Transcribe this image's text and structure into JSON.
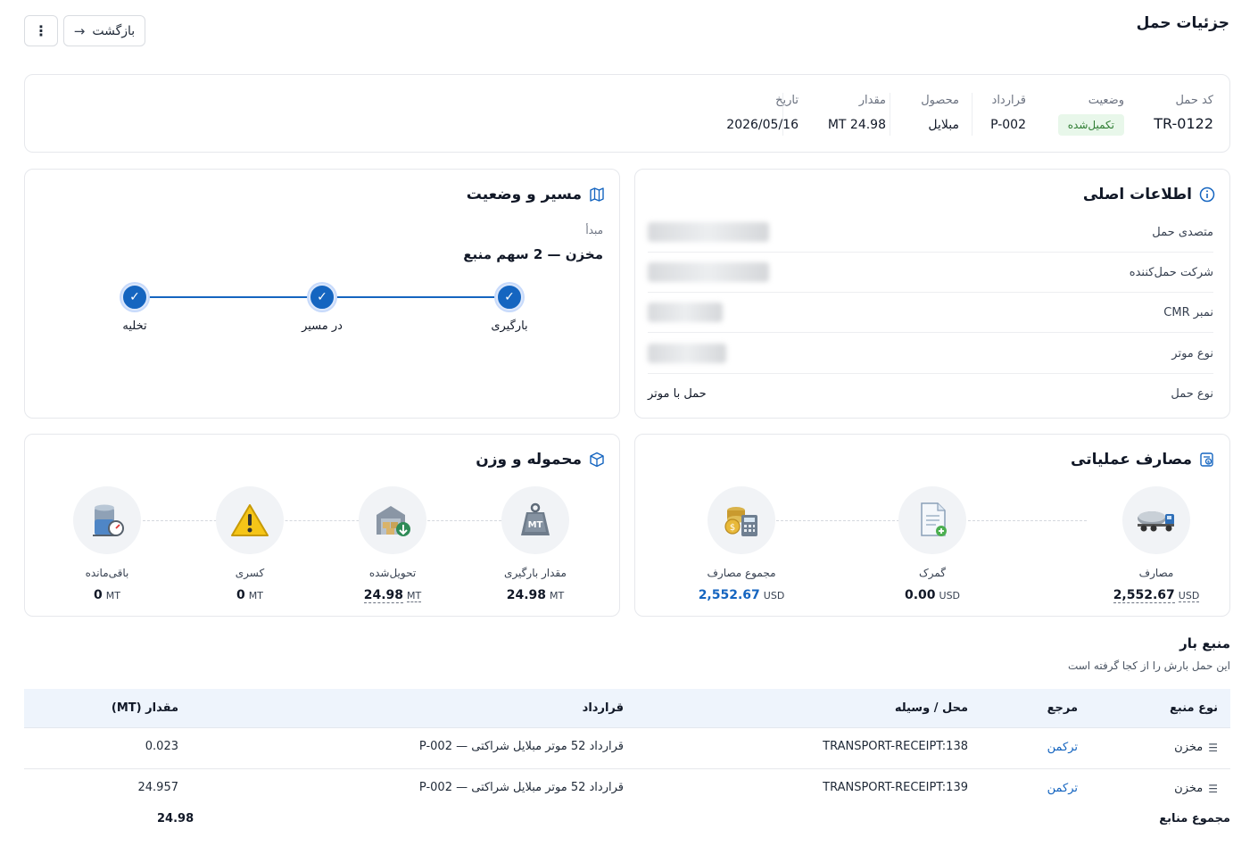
{
  "page": {
    "title": "جزئیات حمل"
  },
  "toolbar": {
    "back_label": "بازگشت",
    "more_label": "⋮"
  },
  "summary": {
    "code_label": "کد حمل",
    "code_value": "TR-0122",
    "status_label": "وضعیت",
    "status_value": "تکمیل‌شده",
    "contract_label": "قرارداد",
    "contract_value": "P-002",
    "product_label": "محصول",
    "product_value": "مبلایل",
    "amount_label": "مقدار",
    "amount_value": "24.98 MT",
    "date_label": "تاریخ",
    "date_value": "2026/05/16"
  },
  "main_info": {
    "title": "اطلاعات اصلی",
    "rows": [
      {
        "label": "متصدی حمل",
        "value": ""
      },
      {
        "label": "شرکت حمل‌کننده",
        "value": ""
      },
      {
        "label": "نمبر CMR",
        "value": ""
      },
      {
        "label": "نوع موتر",
        "value": ""
      },
      {
        "label": "نوع حمل",
        "value": "حمل با موتر"
      }
    ]
  },
  "route": {
    "title": "مسیر و وضعیت",
    "origin_label": "مبدأ",
    "origin_value": "مخزن — 2 سهم منبع",
    "steps": [
      "بارگیری",
      "در مسیر",
      "تخلیه"
    ]
  },
  "costs": {
    "title": "مصارف عملیاتی",
    "items": [
      {
        "label": "مصارف",
        "value": "2,552.67",
        "unit": "USD"
      },
      {
        "label": "گمرک",
        "value": "0.00",
        "unit": "USD"
      },
      {
        "label": "مجموع مصارف",
        "value": "2,552.67",
        "unit": "USD"
      }
    ]
  },
  "cargo": {
    "title": "محموله و وزن",
    "items": [
      {
        "label": "مقدار بارگیری",
        "value": "24.98",
        "unit": "MT"
      },
      {
        "label": "تحویل‌شده",
        "value": "24.98",
        "unit": "MT"
      },
      {
        "label": "کسری",
        "value": "0",
        "unit": "MT"
      },
      {
        "label": "باقی‌مانده",
        "value": "0",
        "unit": "MT"
      }
    ]
  },
  "source": {
    "title": "منبع بار",
    "subtitle": "این حمل بارش را از کجا گرفته است",
    "columns": [
      "نوع منبع",
      "مرجع",
      "محل / وسیله",
      "قرارداد",
      "مقدار (MT)"
    ],
    "rows": [
      {
        "type": "مخزن",
        "ref": "ترکمن",
        "place": "TRANSPORT-RECEIPT:138",
        "contract": "قرارداد 52 موتر مبلایل شراکتی — P-002",
        "qty": "0.023"
      },
      {
        "type": "مخزن",
        "ref": "ترکمن",
        "place": "TRANSPORT-RECEIPT:139",
        "contract": "قرارداد 52 موتر مبلایل شراکتی — P-002",
        "qty": "24.957"
      }
    ],
    "total_label": "مجموع منابع",
    "total_value": "24.98"
  },
  "colors": {
    "accent": "#1565c0",
    "success_bg": "#e8f7ea",
    "success_text": "#2e7d32",
    "header_bg": "#eef4fc"
  }
}
